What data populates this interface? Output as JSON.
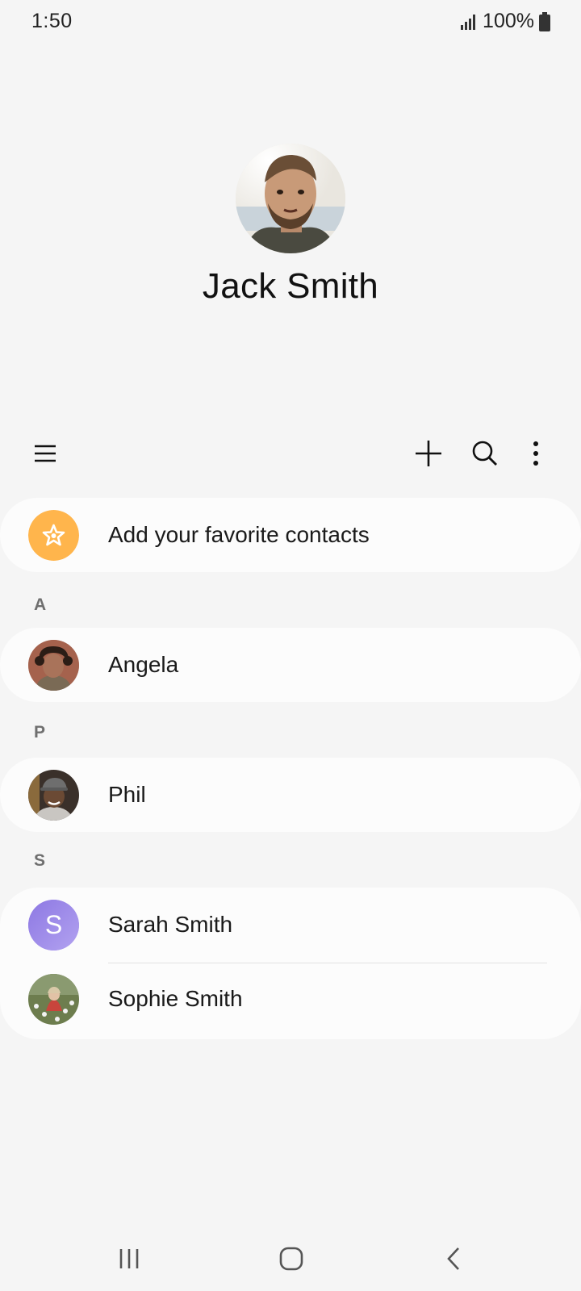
{
  "status": {
    "time": "1:50",
    "battery": "100%"
  },
  "profile": {
    "name": "Jack Smith"
  },
  "favorites": {
    "label": "Add your favorite contacts",
    "accent": "#ffb54c"
  },
  "sections": [
    {
      "letter": "A",
      "contacts": [
        "Angela"
      ]
    },
    {
      "letter": "P",
      "contacts": [
        "Phil"
      ]
    },
    {
      "letter": "S",
      "contacts": [
        "Sarah Smith",
        "Sophie Smith"
      ]
    }
  ],
  "sarah_initial": "S",
  "colors": {
    "background": "#f5f5f5",
    "card": "#fcfcfc",
    "sarah_avatar": "#9b87e8"
  }
}
